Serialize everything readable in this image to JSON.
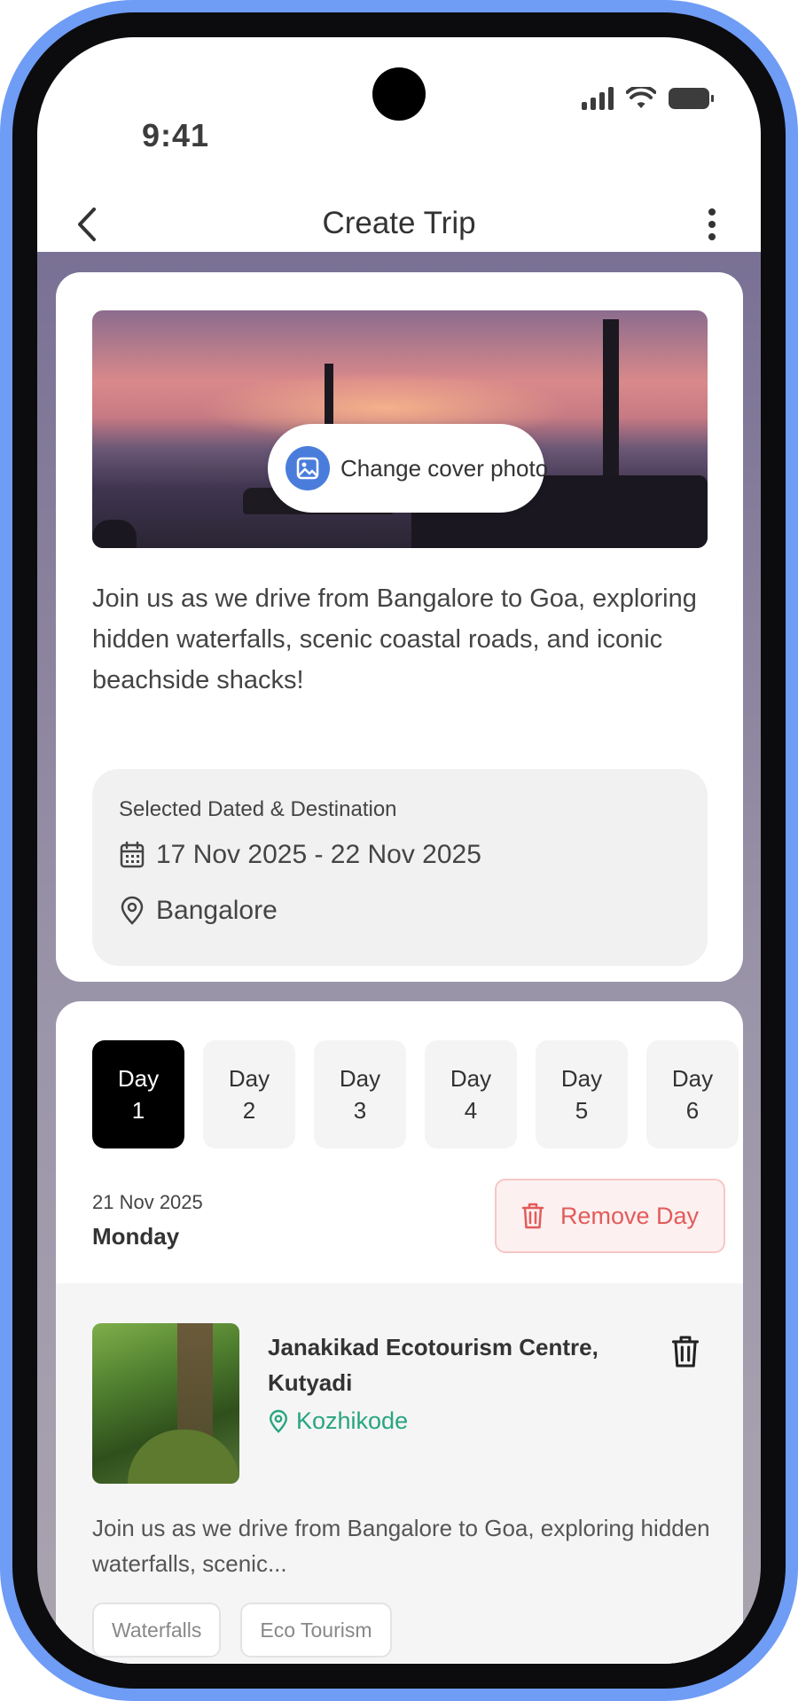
{
  "status_bar": {
    "time": "9:41"
  },
  "header": {
    "title": "Create Trip"
  },
  "cover": {
    "change_label": "Change cover photo"
  },
  "trip": {
    "description": "Join us as we drive from Bangalore to Goa, exploring hidden waterfalls, scenic coastal roads, and iconic beachside shacks!",
    "selection_title": "Selected Dated & Destination",
    "date_range": "17 Nov 2025 - 22 Nov 2025",
    "destination": "Bangalore"
  },
  "itinerary": {
    "days": [
      {
        "label": "Day",
        "number": "1",
        "active": true
      },
      {
        "label": "Day",
        "number": "2",
        "active": false
      },
      {
        "label": "Day",
        "number": "3",
        "active": false
      },
      {
        "label": "Day",
        "number": "4",
        "active": false
      },
      {
        "label": "Day",
        "number": "5",
        "active": false
      },
      {
        "label": "Day",
        "number": "6",
        "active": false
      }
    ],
    "selected_date": "21 Nov 2025",
    "selected_weekday": "Monday",
    "remove_day_label": "Remove Day",
    "place": {
      "name": "Janakikad Ecotourism Centre, Kutyadi",
      "location": "Kozhikode",
      "description": "Join us as we drive from Bangalore to Goa, exploring hidden waterfalls, scenic...",
      "tags": [
        "Waterfalls",
        "Eco Tourism"
      ]
    }
  },
  "colors": {
    "frame": "#6f9cf5",
    "accent_blue": "#4a7ddb",
    "danger": "#e25b5b",
    "location_green": "#28a57f",
    "active_tab": "#000000"
  },
  "icons": {
    "back": "chevron-left-icon",
    "more": "more-vertical-icon",
    "photo": "image-icon",
    "calendar": "calendar-icon",
    "pin": "map-pin-icon",
    "trash": "trash-icon"
  }
}
